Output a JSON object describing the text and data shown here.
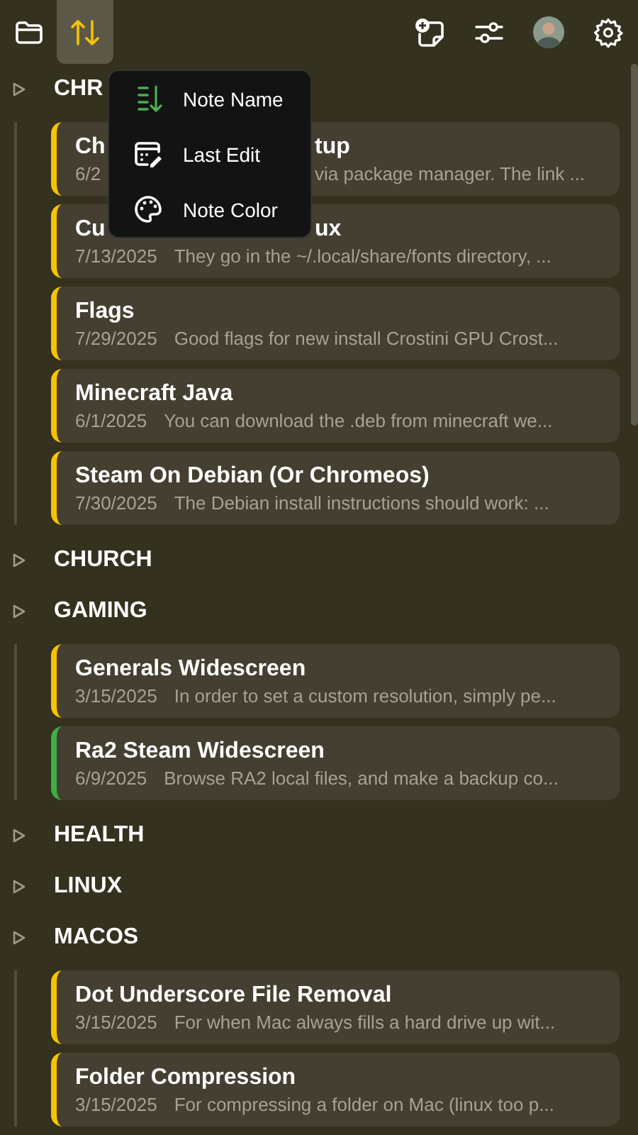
{
  "toolbar": {
    "left": [
      {
        "kind": "folder",
        "selected": false
      },
      {
        "kind": "sort",
        "selected": true
      }
    ],
    "right": [
      {
        "kind": "new-note"
      },
      {
        "kind": "filters"
      },
      {
        "kind": "avatar"
      },
      {
        "kind": "settings"
      }
    ]
  },
  "sort_menu": {
    "items": [
      {
        "kind": "name",
        "label": "Note Name"
      },
      {
        "kind": "edit",
        "label": "Last Edit"
      },
      {
        "kind": "color",
        "label": "Note Color"
      }
    ]
  },
  "groups": [
    {
      "name": "CHR",
      "notes": [
        {
          "title_parts": [
            "Ch",
            "tup"
          ],
          "date_parts": [
            "6/2",
            "via package manager. The link ..."
          ],
          "color": "#f5c400"
        },
        {
          "title_parts": [
            "Cu",
            "ux"
          ],
          "date": "7/13/2025",
          "preview": "They go in the ~/.local/share/fonts directory, ...",
          "color": "#f5c400"
        },
        {
          "title": "Flags",
          "date": "7/29/2025",
          "preview": "Good flags for new install Crostini GPU Crost...",
          "color": "#f5c400"
        },
        {
          "title": "Minecraft Java",
          "date": "6/1/2025",
          "preview": "You can download the .deb from minecraft we...",
          "color": "#f5c400"
        },
        {
          "title": "Steam On Debian (Or Chromeos)",
          "date": "7/30/2025",
          "preview": "The Debian install instructions should work: ...",
          "color": "#f5c400"
        }
      ]
    },
    {
      "name": "CHURCH"
    },
    {
      "name": "GAMING",
      "notes": [
        {
          "title": "Generals Widescreen",
          "date": "3/15/2025",
          "preview": "In order to set a custom resolution, simply pe...",
          "color": "#f5c400"
        },
        {
          "title": "Ra2 Steam Widescreen",
          "date": "6/9/2025",
          "preview": "Browse RA2 local files, and make a backup co...",
          "color": "#3fae49"
        }
      ]
    },
    {
      "name": "HEALTH"
    },
    {
      "name": "LINUX"
    },
    {
      "name": "MACOS",
      "notes": [
        {
          "title": "Dot Underscore File Removal",
          "date": "3/15/2025",
          "preview": "For when Mac always fills a hard drive up wit...",
          "color": "#f5c400"
        },
        {
          "title": "Folder Compression",
          "date": "3/15/2025",
          "preview": "For compressing a folder on Mac (linux too p...",
          "color": "#f5c400"
        }
      ]
    }
  ]
}
